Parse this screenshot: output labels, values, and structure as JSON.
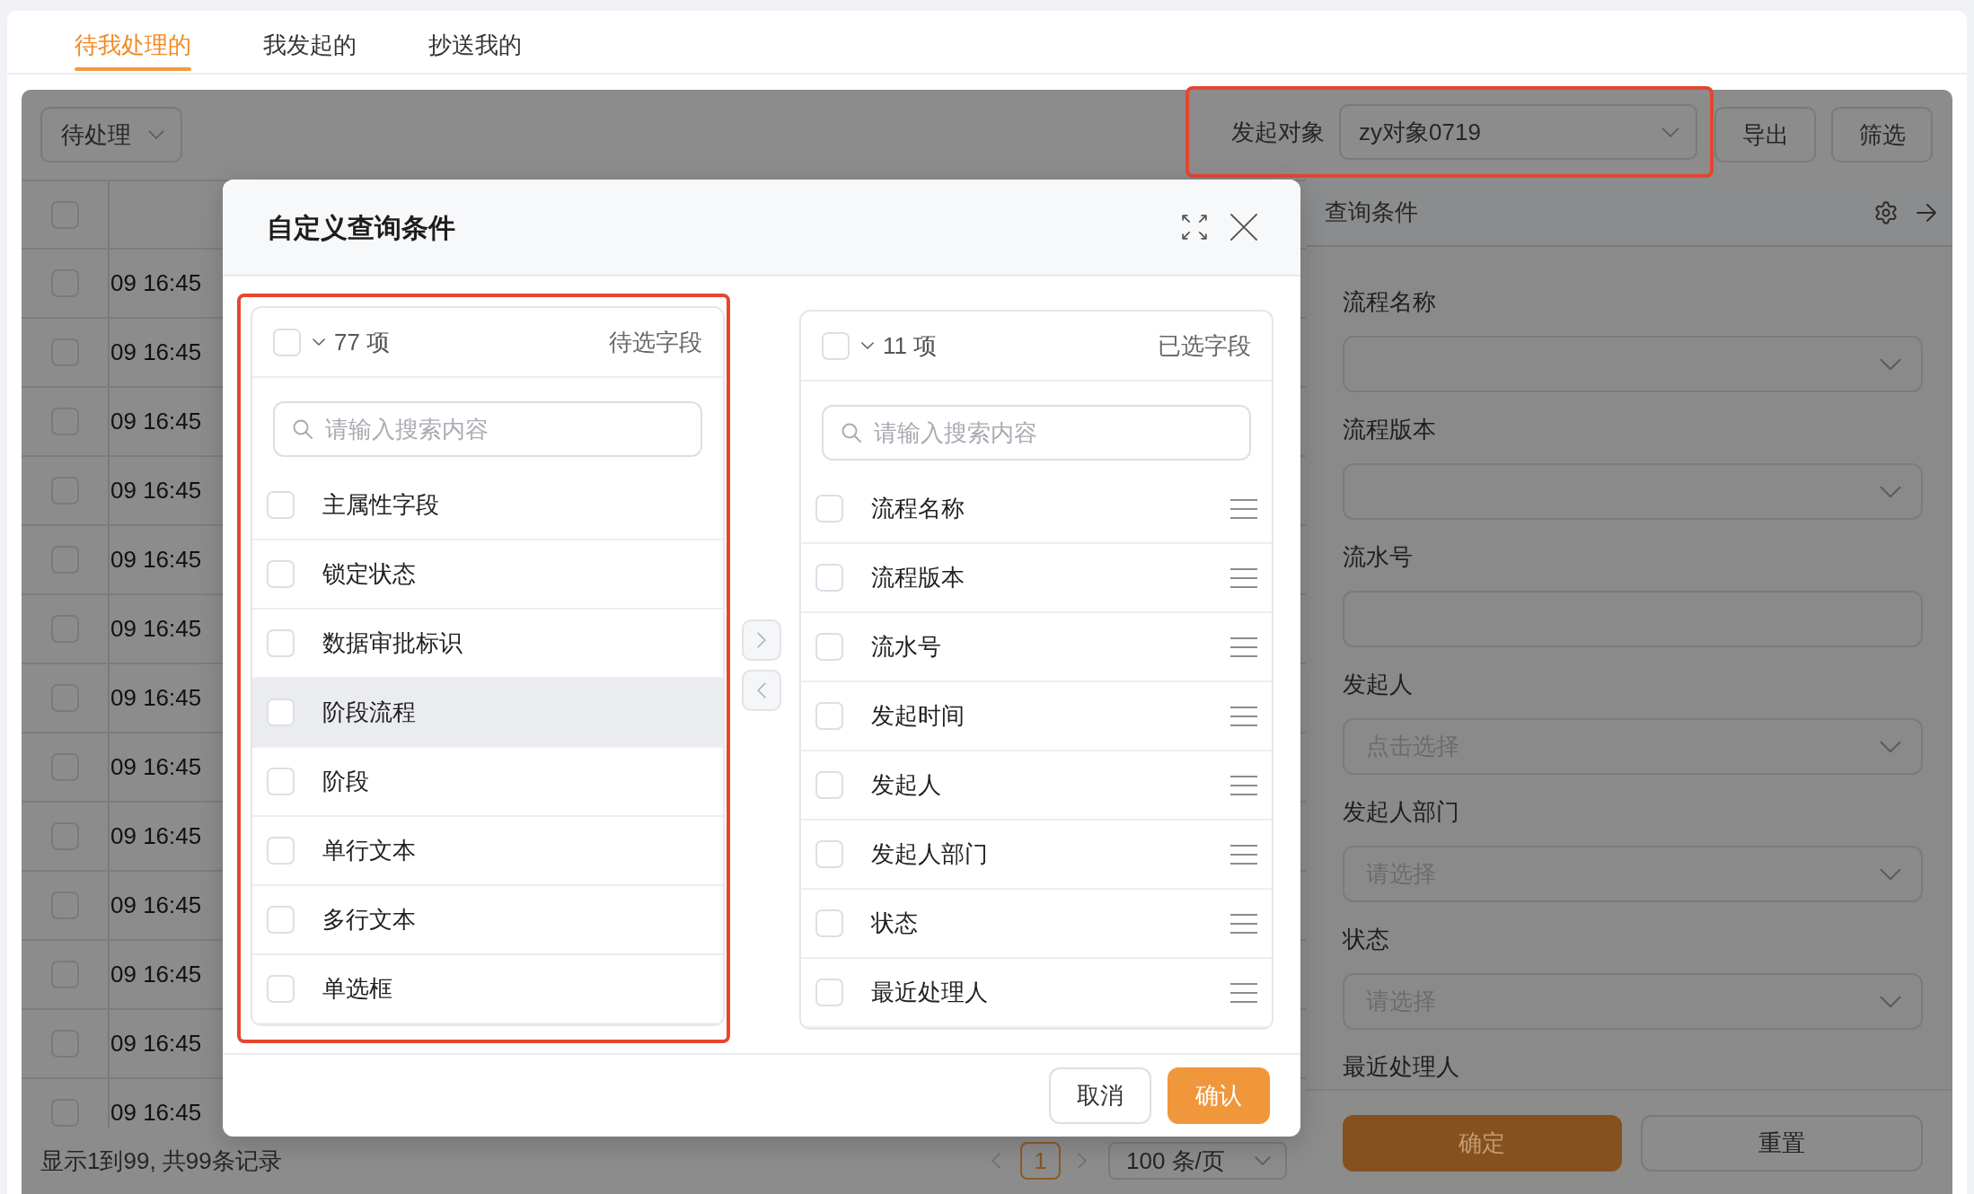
{
  "tabs": [
    {
      "label": "待我处理的",
      "selected": true
    },
    {
      "label": "我发起的",
      "selected": false
    },
    {
      "label": "抄送我的",
      "selected": false
    }
  ],
  "toolbar": {
    "status_select": "待处理",
    "object_filter": {
      "label": "发起对象",
      "value": "zy对象0719",
      "highlighted": true
    },
    "buttons": [
      "导出",
      "筛选"
    ]
  },
  "table": {
    "header_checked": false,
    "rows": [
      {
        "checked": false,
        "column_2": "09 16:45"
      },
      {
        "checked": false,
        "column_2": "09 16:45"
      },
      {
        "checked": false,
        "column_2": "09 16:45"
      },
      {
        "checked": false,
        "column_2": "09 16:45"
      },
      {
        "checked": false,
        "column_2": "09 16:45"
      },
      {
        "checked": false,
        "column_2": "09 16:45"
      },
      {
        "checked": false,
        "column_2": "09 16:45"
      },
      {
        "checked": false,
        "column_2": "09 16:45"
      },
      {
        "checked": false,
        "column_2": "09 16:45"
      },
      {
        "checked": false,
        "column_2": "09 16:45"
      },
      {
        "checked": false,
        "column_2": "09 16:45"
      },
      {
        "checked": false,
        "column_2": "09 16:45"
      },
      {
        "checked": false,
        "column_2": "09 16:45"
      }
    ]
  },
  "pagination": {
    "summary": "显示1到99, 共99条记录",
    "pages": [
      {
        "label": "1",
        "selected": true
      }
    ],
    "page_size": "100 条/页"
  },
  "query_panel": {
    "title": "查询条件",
    "fields": [
      {
        "label": "流程名称",
        "kind": "select"
      },
      {
        "label": "流程版本",
        "kind": "select"
      },
      {
        "label": "流水号",
        "kind": "input"
      },
      {
        "label": "发起人",
        "kind": "select",
        "placeholder": "点击选择"
      },
      {
        "label": "发起人部门",
        "kind": "select",
        "placeholder": "请选择"
      },
      {
        "label": "状态",
        "kind": "select",
        "placeholder": "请选择"
      },
      {
        "label": "最近处理人"
      }
    ],
    "buttons": [
      {
        "label": "确定",
        "kind": "primary"
      },
      {
        "label": "重置",
        "kind": "default"
      }
    ]
  },
  "dialog": {
    "title": "自定义查询条件",
    "source_list": {
      "highlighted": true,
      "draggable": false,
      "all_checked": false,
      "count": "77 项",
      "title": "待选字段",
      "search": {
        "placeholder": "请输入搜索内容"
      },
      "items": [
        {
          "label": "主属性字段",
          "checked": false,
          "hovered": false
        },
        {
          "label": "锁定状态",
          "checked": false,
          "hovered": false
        },
        {
          "label": "数据审批标识",
          "checked": false,
          "hovered": false
        },
        {
          "label": "阶段流程",
          "checked": false,
          "hovered": true
        },
        {
          "label": "阶段",
          "checked": false,
          "hovered": false
        },
        {
          "label": "单行文本",
          "checked": false,
          "hovered": false
        },
        {
          "label": "多行文本",
          "checked": false,
          "hovered": false
        },
        {
          "label": "单选框",
          "checked": false,
          "hovered": false
        }
      ]
    },
    "transfer_buttons": [
      {
        "kind": "right",
        "disabled": true
      },
      {
        "kind": "left",
        "disabled": true
      }
    ],
    "target_list": {
      "highlighted": false,
      "draggable": true,
      "all_checked": false,
      "count": "11 项",
      "title": "已选字段",
      "search": {
        "placeholder": "请输入搜索内容"
      },
      "items": [
        {
          "label": "流程名称",
          "checked": false,
          "hovered": false
        },
        {
          "label": "流程版本",
          "checked": false,
          "hovered": false
        },
        {
          "label": "流水号",
          "checked": false,
          "hovered": false
        },
        {
          "label": "发起时间",
          "checked": false,
          "hovered": false
        },
        {
          "label": "发起人",
          "checked": false,
          "hovered": false
        },
        {
          "label": "发起人部门",
          "checked": false,
          "hovered": false
        },
        {
          "label": "状态",
          "checked": false,
          "hovered": false
        },
        {
          "label": "最近处理人",
          "checked": false,
          "hovered": false
        }
      ]
    },
    "buttons": [
      {
        "label": "取消",
        "kind": "default"
      },
      {
        "label": "确认",
        "kind": "primary"
      }
    ]
  }
}
